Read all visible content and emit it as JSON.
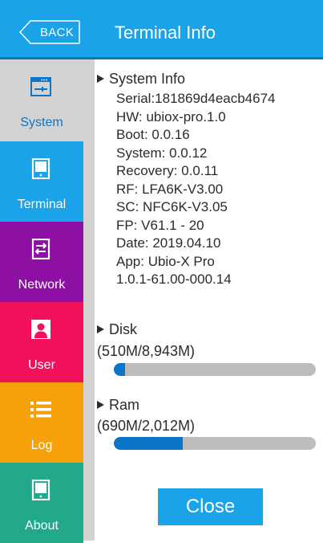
{
  "header": {
    "back_label": "BACK",
    "title": "Terminal Info"
  },
  "sidebar": {
    "items": [
      {
        "label": "System",
        "icon": "system-icon",
        "color": "#d4d2d0",
        "text_color": "#0b76c9",
        "active": true
      },
      {
        "label": "Terminal",
        "icon": "terminal-icon",
        "color": "#1aa3e8",
        "text_color": "#ffffff"
      },
      {
        "label": "Network",
        "icon": "network-icon",
        "color": "#8e0fa3",
        "text_color": "#ffffff"
      },
      {
        "label": "User",
        "icon": "user-icon",
        "color": "#f2125b",
        "text_color": "#ffffff"
      },
      {
        "label": "Log",
        "icon": "log-icon",
        "color": "#f6a10b",
        "text_color": "#ffffff"
      },
      {
        "label": "About",
        "icon": "about-icon",
        "color": "#22a98b",
        "text_color": "#ffffff"
      }
    ]
  },
  "system_info": {
    "heading": "System Info",
    "lines": [
      "Serial:181869d4eacb4674",
      "HW: ubiox-pro.1.0",
      "Boot: 0.0.16",
      "System: 0.0.12",
      "Recovery: 0.0.11",
      "RF: LFA6K-V3.00",
      "SC: NFC6K-V3.05",
      "FP: V61.1 - 20",
      "Date: 2019.04.10",
      "App: Ubio-X Pro",
      "1.0.1-61.00-000.14"
    ]
  },
  "disk": {
    "heading": "Disk",
    "usage": "(510M/8,943M)",
    "fraction": 0.057
  },
  "ram": {
    "heading": "Ram",
    "usage": "(690M/2,012M)",
    "fraction": 0.343
  },
  "close_label": "Close"
}
